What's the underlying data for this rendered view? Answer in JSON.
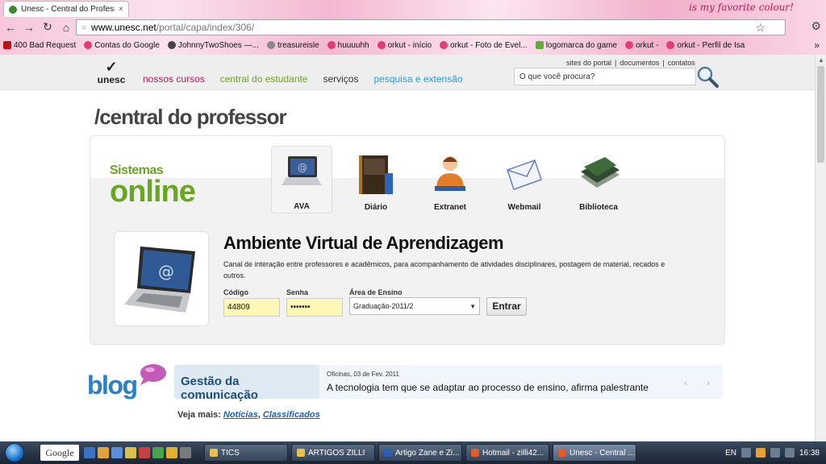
{
  "browser": {
    "tab_title": "Unesc - Central do Professo",
    "tab_close": "×",
    "decor_text": "is my favorite colour!",
    "url_host": "www.unesc.net",
    "url_path": "/portal/capa/index/306/",
    "bookmarks": [
      {
        "label": "400 Bad Request",
        "icon": "opera-icon"
      },
      {
        "label": "Contas do Google",
        "icon": "orkut-icon"
      },
      {
        "label": "JohnnyTwoShoes —...",
        "icon": "johnny-icon"
      },
      {
        "label": "treasureisle",
        "icon": "globe-icon"
      },
      {
        "label": "huuuuhh",
        "icon": "orkut-icon"
      },
      {
        "label": "orkut - início",
        "icon": "orkut-icon"
      },
      {
        "label": "orkut - Foto de Evel...",
        "icon": "orkut-icon"
      },
      {
        "label": "logomarca do game",
        "icon": "image-icon"
      },
      {
        "label": "orkut -",
        "icon": "orkut-icon"
      },
      {
        "label": "orkut - Perfil de Isa",
        "icon": "orkut-icon"
      }
    ],
    "bookmarks_more": "»"
  },
  "site": {
    "logo_text": "unesc",
    "nav": [
      "nossos cursos",
      "central do estudante",
      "serviços",
      "pesquisa e extensão"
    ],
    "top_links": [
      "sites do portal",
      "|",
      "documentos",
      "|",
      "contatos"
    ],
    "search_placeholder": "O que você procura?"
  },
  "page_title": "/central do professor",
  "systems": {
    "logo_line1": "Sistemas",
    "logo_line2": "online",
    "items": [
      {
        "label": "AVA",
        "icon": "laptop-icon",
        "active": true
      },
      {
        "label": "Diário",
        "icon": "diary-book-icon",
        "active": false
      },
      {
        "label": "Extranet",
        "icon": "person-icon",
        "active": false
      },
      {
        "label": "Webmail",
        "icon": "envelope-icon",
        "active": false
      },
      {
        "label": "Biblioteca",
        "icon": "books-icon",
        "active": false
      }
    ]
  },
  "ava": {
    "title": "Ambiente Virtual de Aprendizagem",
    "description": "Canal de interação entre professores e acadêmicos, para acompanhamento de atividades disciplinares, postagem de material, recados e outros.",
    "code_label": "Código",
    "code_value": "44809",
    "password_label": "Senha",
    "password_value": "•••••••",
    "area_label": "Área de Ensino",
    "area_value": "Graduação-2011/2",
    "submit_label": "Entrar"
  },
  "blog": {
    "logo_text": "blog",
    "category": "Gestão da comunicação",
    "date": "Oficinas, 03 de Fev. 2011",
    "headline": "A tecnologia tem que se adaptar ao processo de ensino, afirma palestrante",
    "prev": "‹",
    "next": "›",
    "more_label": "Veja mais:",
    "more_links": [
      "Notícias",
      "Classificados"
    ]
  },
  "taskbar": {
    "search_label": "Google",
    "tasks": [
      {
        "label": "TICS",
        "color": "#e8c24a"
      },
      {
        "label": "ARTIGOS ZILLI",
        "color": "#e8c24a"
      },
      {
        "label": "Artigo Zane e Zi...",
        "color": "#2b5fb3"
      },
      {
        "label": "Hotmail - zilli42...",
        "color": "#e05a2b"
      },
      {
        "label": "Unesc - Central ...",
        "color": "#e05a2b"
      }
    ],
    "lang": "EN",
    "clock": "16:38"
  }
}
